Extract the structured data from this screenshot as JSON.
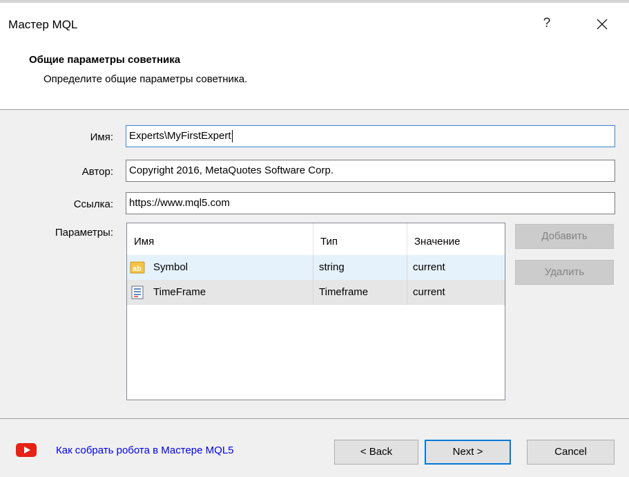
{
  "window": {
    "title": "Мастер MQL",
    "help_label": "?",
    "close_icon": "close-icon"
  },
  "header": {
    "title": "Общие параметры советника",
    "subtitle": "Определите общие параметры советника."
  },
  "form": {
    "name_label": "Имя:",
    "name_value": "Experts\\MyFirstExpert",
    "author_label": "Автор:",
    "author_value": "Copyright 2016, MetaQuotes Software Corp.",
    "link_label": "Ссылка:",
    "link_value": "https://www.mql5.com",
    "params_label": "Параметры:"
  },
  "params_table": {
    "columns": [
      "Имя",
      "Тип",
      "Значение"
    ],
    "rows": [
      {
        "name": "Symbol",
        "type": "string",
        "value": "current",
        "icon": "string-type-icon"
      },
      {
        "name": "TimeFrame",
        "type": "Timeframe",
        "value": "current",
        "icon": "list-type-icon"
      }
    ]
  },
  "side_buttons": {
    "add": "Добавить",
    "remove": "Удалить"
  },
  "footer": {
    "link_text": "Как собрать робота в Мастере MQL5",
    "back": "< Back",
    "next": "Next >",
    "cancel": "Cancel"
  },
  "colors": {
    "accent": "#0078d7",
    "link": "#0000ee",
    "youtube_red": "#e62117",
    "selected_row": "#e5f1fb"
  }
}
